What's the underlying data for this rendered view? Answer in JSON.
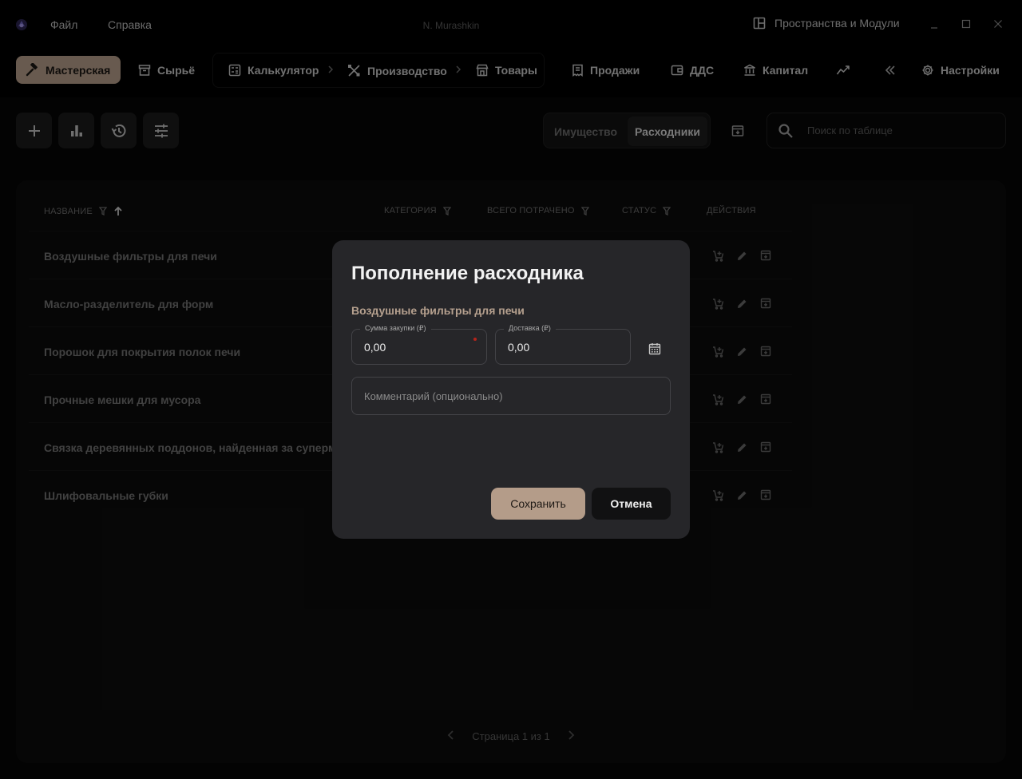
{
  "window": {
    "user": "N. Murashkin",
    "menu": {
      "file": "Файл",
      "help": "Справка"
    },
    "spaces_label": "Пространства и Модули",
    "controls": {
      "minimize": "minimize-icon",
      "maximize": "maximize-icon",
      "close": "close-icon"
    }
  },
  "nav": {
    "workshop": "Мастерская",
    "raw": "Сырьё",
    "calculator": "Калькулятор",
    "production": "Производство",
    "goods": "Товары",
    "sales": "Продажи",
    "dds": "ДДС",
    "capital": "Капитал",
    "settings": "Настройки",
    "active": "workshop",
    "accent_color": "#b49c89"
  },
  "toolbar": {
    "buttons": [
      "add-icon",
      "chart-icon",
      "history-icon",
      "tune-icon"
    ],
    "segment": {
      "property": "Имущество",
      "consumables": "Расходники",
      "active": "consumables"
    },
    "search_placeholder": "Поиск по таблице"
  },
  "table": {
    "columns": {
      "name": "НАЗВАНИЕ",
      "category": "КАТЕГОРИЯ",
      "spent": "ВСЕГО ПОТРАЧЕНО",
      "status": "СТАТУС",
      "actions": "ДЕЙСТВИЯ"
    },
    "sort": {
      "column": "name",
      "direction": "asc"
    },
    "rows": [
      {
        "name": "Воздушные фильтры для печи"
      },
      {
        "name": "Масло-разделитель для форм"
      },
      {
        "name": "Порошок для покрытия полок печи"
      },
      {
        "name": "Прочные мешки для мусора"
      },
      {
        "name": "Связка деревянных поддонов, найденная за супермаркетом"
      },
      {
        "name": "Шлифовальные губки"
      }
    ],
    "row_actions": [
      "cart-plus-icon",
      "pencil-icon",
      "archive-icon"
    ],
    "pagination": "Страница 1 из 1"
  },
  "modal": {
    "title": "Пополнение расходника",
    "subtitle": "Воздушные фильтры для печи",
    "purchase_label": "Сумма закупки (₽)",
    "purchase_value": "0,00",
    "delivery_label": "Доставка (₽)",
    "delivery_value": "0,00",
    "comment_placeholder": "Комментарий (опционально)",
    "save": "Сохранить",
    "cancel": "Отмена",
    "required_color": "#b5241b"
  }
}
